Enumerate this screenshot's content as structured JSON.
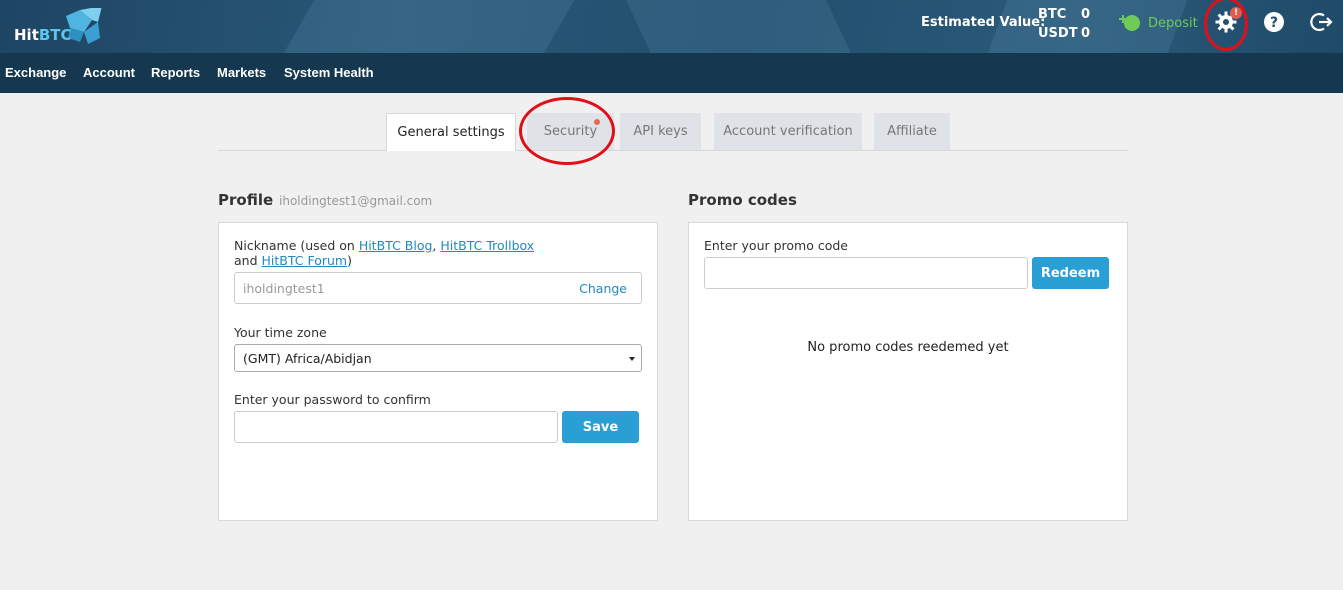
{
  "brand": {
    "logo_text_1": "Hit",
    "logo_text_2": "BTC"
  },
  "header": {
    "estimated_label": "Estimated Value:",
    "balances": [
      {
        "currency": "BTC",
        "amount": "0"
      },
      {
        "currency": "USDT",
        "amount": "0"
      }
    ],
    "deposit_label": "Deposit",
    "notification_badge": "!"
  },
  "nav": {
    "items": [
      "Exchange",
      "Account",
      "Reports",
      "Markets",
      "System Health"
    ]
  },
  "tabs": [
    {
      "label": "General settings",
      "active": true
    },
    {
      "label": "Security",
      "active": false,
      "has_dot": true
    },
    {
      "label": "API keys",
      "active": false
    },
    {
      "label": "Account verification",
      "active": false
    },
    {
      "label": "Affiliate",
      "active": false
    }
  ],
  "profile": {
    "title": "Profile",
    "email": "iholdingtest1@gmail.com",
    "nickname_label_pre": "Nickname (used on ",
    "nickname_link_blog": "HitBTC Blog",
    "nickname_sep": ", ",
    "nickname_link_trollbox": "HitBTC Trollbox",
    "nickname_and": "and ",
    "nickname_link_forum": "HitBTC Forum",
    "nickname_close": ")",
    "nickname_value": "iholdingtest1",
    "change_label": "Change",
    "timezone_label": "Your time zone",
    "timezone_value": "(GMT) Africa/Abidjan",
    "password_label": "Enter your password to confirm",
    "password_value": "",
    "save_label": "Save"
  },
  "promo": {
    "title": "Promo codes",
    "input_label": "Enter your promo code",
    "input_value": "",
    "redeem_label": "Redeem",
    "empty_message": "No promo codes reedemed yet"
  },
  "colors": {
    "accent": "#2a9fd6",
    "deposit": "#6fcb58",
    "navbar": "#153750",
    "annotation": "#e0101a"
  }
}
